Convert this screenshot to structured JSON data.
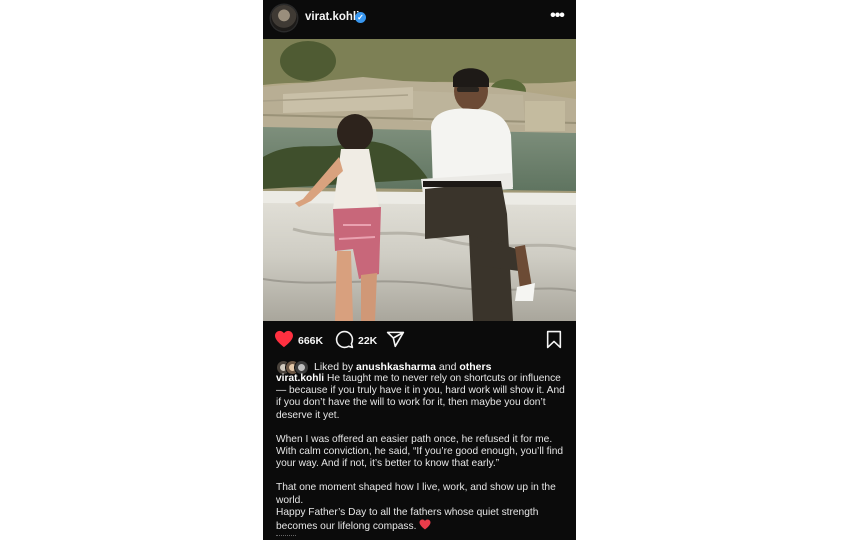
{
  "post": {
    "username": "virat.kohli",
    "verified_mark": "✓",
    "more_icon": "•••"
  },
  "actions": {
    "likes_count": "666K",
    "comments_count": "22K",
    "icons": [
      "heart-icon",
      "comment-icon",
      "share-icon",
      "bookmark-icon"
    ],
    "heart_color": "#ff3040"
  },
  "likes": {
    "prefix": "Liked by ",
    "liker": "anushkasharma",
    "conj": " and ",
    "others": "others"
  },
  "caption": {
    "username": "virat.kohli",
    "para1": " He taught me to never rely on shortcuts or influence — because if you truly have it in you, hard work will show it. And if you don’t have the will to work for it, then maybe you don’t deserve it yet.",
    "para2": "When I was offered an easier path once, he refused it for me. With calm conviction, he said, “If you’re good enough, you’ll find your way. And if not, it’s better to know that early.”",
    "para3a": "That one moment shaped how I live, work, and show up in the world.",
    "para3b": "Happy Father’s Day to all the fathers whose quiet strength becomes our lifelong compass."
  },
  "colors": {
    "background": "#0b0b0b",
    "verified": "#3897f0"
  }
}
